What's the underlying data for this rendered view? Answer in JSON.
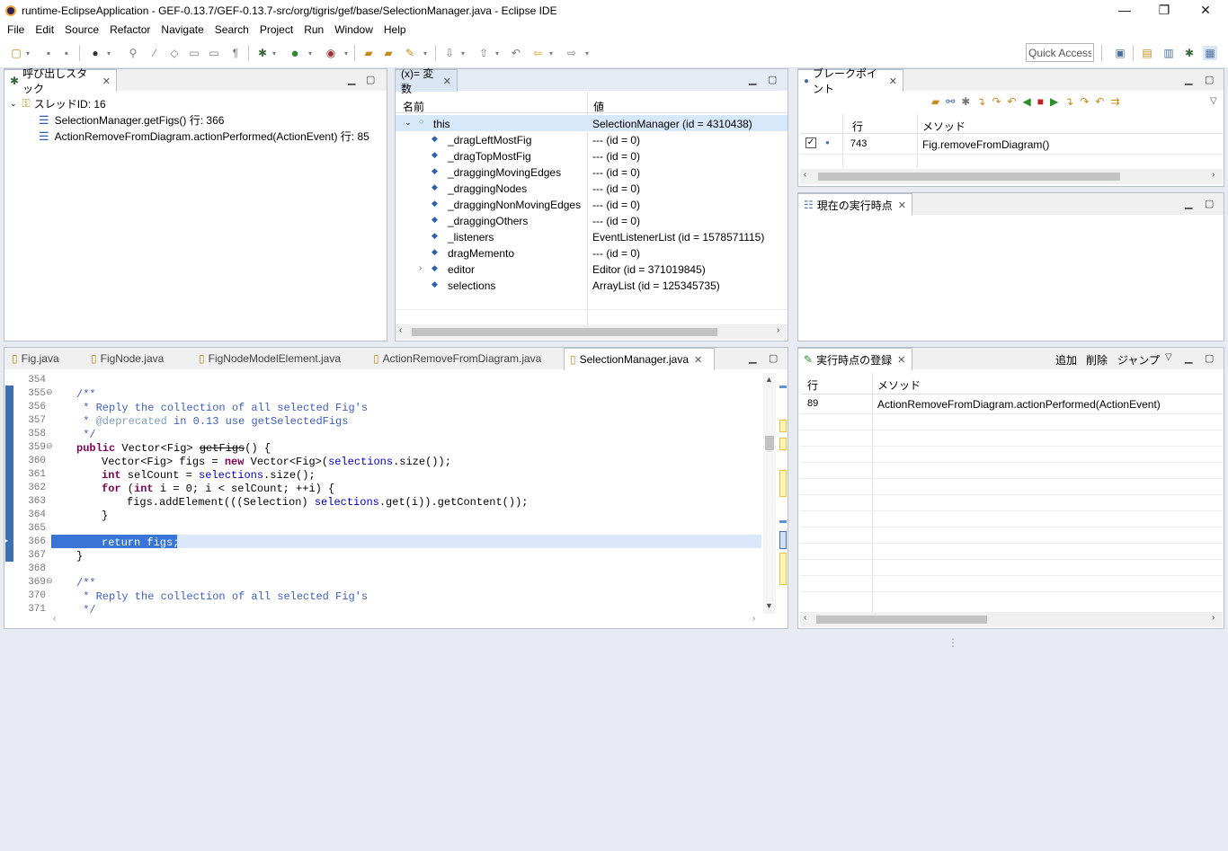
{
  "window": {
    "title": "runtime-EclipseApplication - GEF-0.13.7/GEF-0.13.7-src/org/tigris/gef/base/SelectionManager.java - Eclipse IDE",
    "minimize": "—",
    "restore": "❐",
    "close": "✕"
  },
  "menu": [
    "File",
    "Edit",
    "Source",
    "Refactor",
    "Navigate",
    "Search",
    "Project",
    "Run",
    "Window",
    "Help"
  ],
  "toolbar": {
    "quick_access": "Quick Access"
  },
  "callstack": {
    "tab_label": "呼び出しスタック",
    "thread_label": "スレッドID: 16",
    "frames": [
      "SelectionManager.getFigs() 行: 366",
      "ActionRemoveFromDiagram.actionPerformed(ActionEvent) 行: 85"
    ]
  },
  "variables": {
    "tab_label": "(x)= 変数",
    "col_name": "名前",
    "col_value": "値",
    "rows": [
      {
        "name": "this",
        "value": "SelectionManager (id = 4310438)"
      },
      {
        "name": "_dragLeftMostFig",
        "value": "--- (id = 0)"
      },
      {
        "name": "_dragTopMostFig",
        "value": "--- (id = 0)"
      },
      {
        "name": "_draggingMovingEdges",
        "value": "--- (id = 0)"
      },
      {
        "name": "_draggingNodes",
        "value": "--- (id = 0)"
      },
      {
        "name": "_draggingNonMovingEdges",
        "value": "--- (id = 0)"
      },
      {
        "name": "_draggingOthers",
        "value": "--- (id = 0)"
      },
      {
        "name": "_listeners",
        "value": "EventListenerList (id = 1578571115)"
      },
      {
        "name": "dragMemento",
        "value": "--- (id = 0)"
      },
      {
        "name": "editor",
        "value": "Editor (id = 371019845)"
      },
      {
        "name": "selections",
        "value": "ArrayList (id = 125345735)"
      }
    ]
  },
  "breakpoints": {
    "tab_label": "ブレークポイント",
    "col_line": "行",
    "col_method": "メソッド",
    "rows": [
      {
        "line": "743",
        "method": "Fig.removeFromDiagram()"
      }
    ]
  },
  "current_point": {
    "tab_label": "現在の実行時点"
  },
  "editor": {
    "tabs": [
      "Fig.java",
      "FigNode.java",
      "FigNodeModelElement.java",
      "ActionRemoveFromDiagram.java",
      "SelectionManager.java"
    ],
    "line_numbers": [
      "354",
      "355",
      "356",
      "357",
      "358",
      "359",
      "360",
      "361",
      "362",
      "363",
      "364",
      "365",
      "366",
      "367",
      "368",
      "369",
      "370",
      "371"
    ],
    "lines": {
      "l355": "/**",
      "l356": " * Reply the collection of all selected Fig's",
      "l357a": " * ",
      "l357b": "@deprecated",
      "l357c": " in 0.13 use getSelectedFigs",
      "l358": " */",
      "l359a": "public",
      "l359b": " Vector<Fig> ",
      "l359c": "getFigs",
      "l359d": "() {",
      "l360a": "Vector<Fig> figs = ",
      "l360b": "new",
      "l360c": " Vector<Fig>(",
      "l360d": "selections",
      "l360e": ".size());",
      "l361a": "int",
      "l361b": " selCount = ",
      "l361c": "selections",
      "l361d": ".size();",
      "l362a": "for",
      "l362b": " (",
      "l362c": "int",
      "l362d": " i = 0; i < selCount; ++i) {",
      "l363a": "figs.addElement(((Selection) ",
      "l363b": "selections",
      "l363c": ".get(i)).getContent());",
      "l364": "}",
      "l366": "return figs;",
      "l367": "}",
      "l369": "/**",
      "l370": " * Reply the collection of all selected Fig's",
      "l371": " */"
    }
  },
  "registry": {
    "tab_label": "実行時点の登録",
    "actions": [
      "追加",
      "削除",
      "ジャンプ"
    ],
    "col_line": "行",
    "col_method": "メソッド",
    "rows": [
      {
        "line": "89",
        "method": "ActionRemoveFromDiagram.actionPerformed(ActionEvent)"
      }
    ]
  },
  "colors": {
    "selection": "#3875d7",
    "keyword": "#7f0055",
    "comment": "#3f5fbf",
    "field": "#0000c0",
    "highlight_row": "#d8e8fb"
  }
}
